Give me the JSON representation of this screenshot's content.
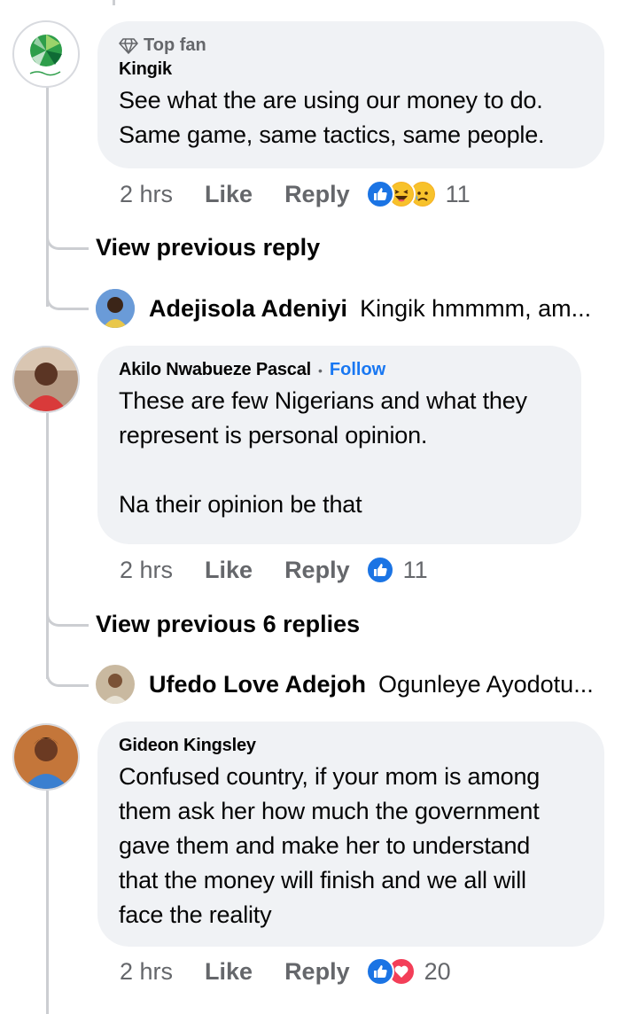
{
  "colors": {
    "accent": "#1877f2",
    "bubble": "#f0f2f5",
    "muted": "#65676b",
    "thread": "#ccced2"
  },
  "comments": [
    {
      "badge": "Top fan",
      "author": "Kingik",
      "text": "See what the are using our money to do.\nSame  game, same tactics, same people.",
      "time": "2 hrs",
      "like_label": "Like",
      "reply_label": "Reply",
      "reactions": [
        "like",
        "haha",
        "sad"
      ],
      "reaction_count": "11",
      "view_previous": "View previous reply",
      "latest_reply": {
        "name": "Adejisola Adeniyi",
        "snippet": "Kingik hmmmm, am..."
      }
    },
    {
      "author": "Akilo Nwabueze Pascal",
      "separator": "•",
      "follow_label": "Follow",
      "text": "These are few Nigerians and what they\nrepresent is personal opinion.\n\nNa their opinion be that",
      "time": "2 hrs",
      "like_label": "Like",
      "reply_label": "Reply",
      "reactions": [
        "like"
      ],
      "reaction_count": "11",
      "view_previous": "View previous 6 replies",
      "latest_reply": {
        "name": "Ufedo Love Adejoh",
        "snippet": "Ogunleye Ayodotu..."
      }
    },
    {
      "author": "Gideon Kingsley",
      "text": "Confused country, if your mom is among\nthem ask her how much the government\ngave them and make her to understand\nthat the money will finish and we all will\nface the reality",
      "time": "2 hrs",
      "like_label": "Like",
      "reply_label": "Reply",
      "reactions": [
        "like",
        "love"
      ],
      "reaction_count": "20"
    }
  ]
}
